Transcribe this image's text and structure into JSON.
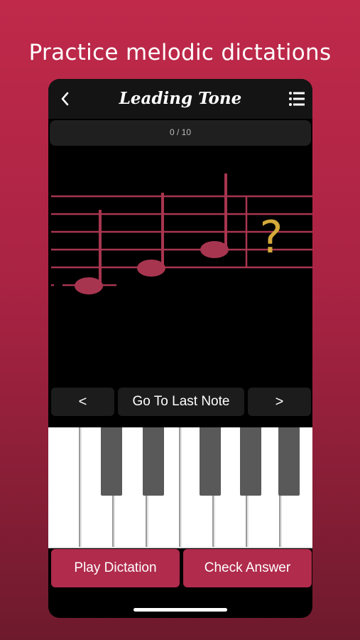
{
  "headline": "Practice melodic dictations",
  "nav": {
    "title": "Leading Tone",
    "back_icon": "chevron-left-icon",
    "menu_icon": "list-icon"
  },
  "progress": {
    "text": "0 / 10",
    "current": 0,
    "total": 10
  },
  "staff": {
    "unknown_symbol": "?",
    "note_color": "#a8354f",
    "question_color": "#d4a93a"
  },
  "controls": {
    "prev_label": "<",
    "go_last_label": "Go To Last Note",
    "next_label": ">"
  },
  "actions": {
    "play_label": "Play Dictation",
    "check_label": "Check Answer"
  },
  "colors": {
    "accent": "#b02b4c",
    "background_top": "#c0294a",
    "background_bottom": "#6e1a2d"
  }
}
